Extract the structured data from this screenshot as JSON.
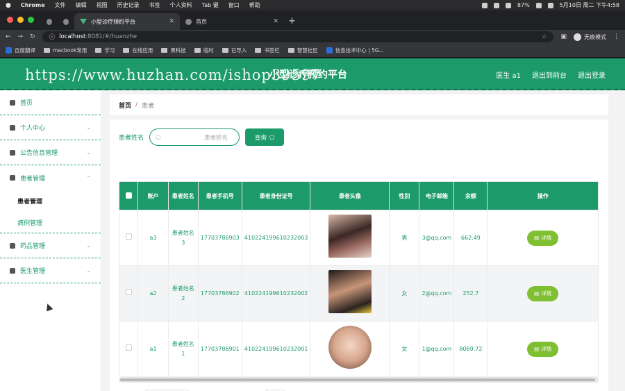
{
  "os_menubar": {
    "app": "Chrome",
    "menus": [
      "文件",
      "编辑",
      "视图",
      "历史记录",
      "书签",
      "个人资料",
      "Tab 键",
      "窗口",
      "帮助"
    ],
    "mem": "87%",
    "datetime": "5月10日 周二 下午4:58"
  },
  "browser": {
    "tabs": [
      {
        "label": "小型诊疗预约平台"
      },
      {
        "label": "首页"
      }
    ],
    "url_host": "localhost",
    "url_path": ":8081/#/huanzhe",
    "profile": "无痕模式",
    "bookmarks": [
      "百度翻译",
      "macbook常用",
      "学习",
      "在线应用",
      "黑科技",
      "临时",
      "已导入",
      "书签栏",
      "智慧社区",
      "信息技术中心 | 5G..."
    ]
  },
  "header": {
    "title": "小型诊疗预约平台",
    "user": "医生 a1",
    "to_front": "退出到前台",
    "logout": "退出登录",
    "watermark": "https://www.huzhan.com/ishop39597"
  },
  "sidebar": {
    "home": "首页",
    "personal": "个人中心",
    "notice": "公告信息管理",
    "patient": "患者管理",
    "patient_sub": "患者管理",
    "record_sub": "病例管理",
    "drug": "药品管理",
    "doctor": "医生管理"
  },
  "breadcrumb": {
    "home": "首页",
    "sep": "/",
    "current": "患者"
  },
  "search": {
    "label": "患者姓名",
    "placeholder": "患者姓名",
    "button": "查询"
  },
  "table": {
    "columns": [
      "账户",
      "患者姓名",
      "患者手机号",
      "患者身份证号",
      "患者头像",
      "性别",
      "电子邮箱",
      "余额",
      "操作"
    ],
    "detail_label": "详情",
    "rows": [
      {
        "account": "a3",
        "name": "患者姓名3",
        "phone": "17703786903",
        "idcard": "410224199610232003",
        "gender": "男",
        "email": "3@qq.com",
        "balance": "662.49"
      },
      {
        "account": "a2",
        "name": "患者姓名2",
        "phone": "17703786902",
        "idcard": "410224199610232002",
        "gender": "女",
        "email": "2@qq.com",
        "balance": "252.7"
      },
      {
        "account": "a1",
        "name": "患者姓名1",
        "phone": "17703786901",
        "idcard": "410224199610232001",
        "gender": "女",
        "email": "1@qq.com",
        "balance": "8069.72"
      }
    ]
  },
  "colors": {
    "primary": "#1c9a6a",
    "detail_button": "#7fbf32"
  }
}
